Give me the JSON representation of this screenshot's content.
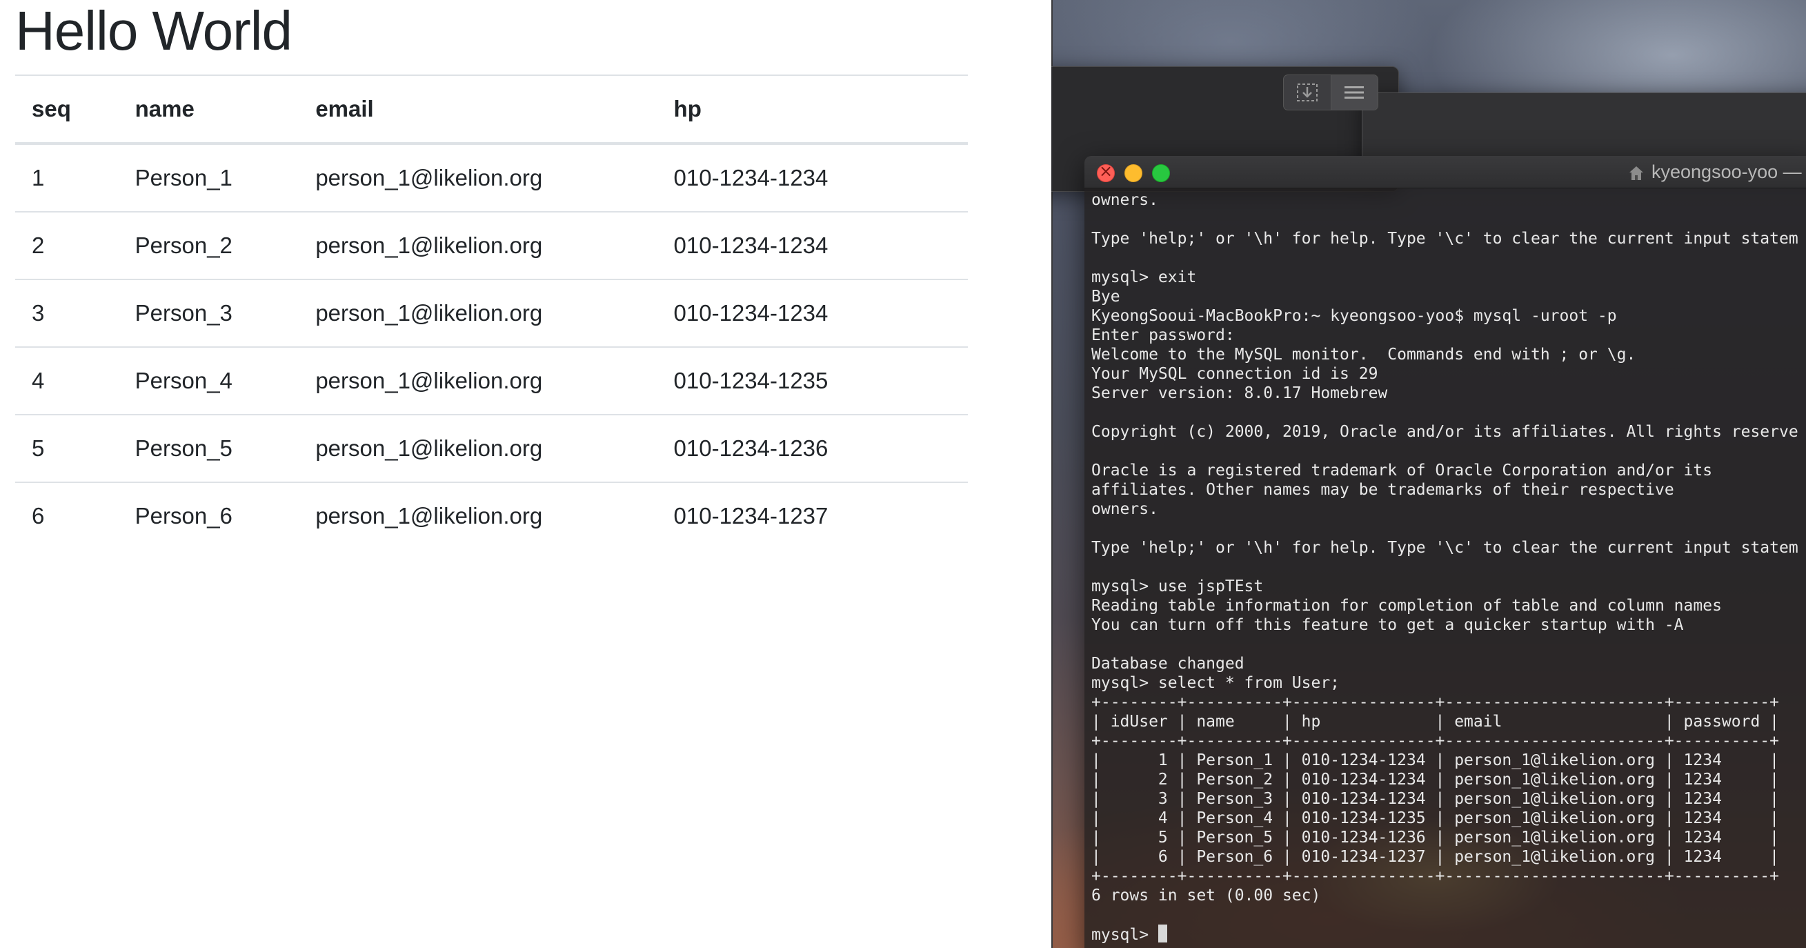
{
  "page": {
    "title": "Hello World",
    "columns": [
      "seq",
      "name",
      "email",
      "hp"
    ],
    "rows": [
      [
        "1",
        "Person_1",
        "person_1@likelion.org",
        "010-1234-1234"
      ],
      [
        "2",
        "Person_2",
        "person_1@likelion.org",
        "010-1234-1234"
      ],
      [
        "3",
        "Person_3",
        "person_1@likelion.org",
        "010-1234-1234"
      ],
      [
        "4",
        "Person_4",
        "person_1@likelion.org",
        "010-1234-1235"
      ],
      [
        "5",
        "Person_5",
        "person_1@likelion.org",
        "010-1234-1236"
      ],
      [
        "6",
        "Person_6",
        "person_1@likelion.org",
        "010-1234-1237"
      ]
    ]
  },
  "terminal": {
    "title": "kyeongsoo-yoo — m",
    "title_icon": "home-icon",
    "lines": [
      "owners.",
      "",
      "Type 'help;' or '\\h' for help. Type '\\c' to clear the current input statem",
      "",
      "mysql> exit",
      "Bye",
      "KyeongSooui-MacBookPro:~ kyeongsoo-yoo$ mysql -uroot -p",
      "Enter password:",
      "Welcome to the MySQL monitor.  Commands end with ; or \\g.",
      "Your MySQL connection id is 29",
      "Server version: 8.0.17 Homebrew",
      "",
      "Copyright (c) 2000, 2019, Oracle and/or its affiliates. All rights reserve",
      "",
      "Oracle is a registered trademark of Oracle Corporation and/or its",
      "affiliates. Other names may be trademarks of their respective",
      "owners.",
      "",
      "Type 'help;' or '\\h' for help. Type '\\c' to clear the current input statem",
      "",
      "mysql> use jspTEst",
      "Reading table information for completion of table and column names",
      "You can turn off this feature to get a quicker startup with -A",
      "",
      "Database changed",
      "mysql> select * from User;",
      "+--------+----------+---------------+-----------------------+----------+",
      "| idUser | name     | hp            | email                 | password |",
      "+--------+----------+---------------+-----------------------+----------+",
      "|      1 | Person_1 | 010-1234-1234 | person_1@likelion.org | 1234     |",
      "|      2 | Person_2 | 010-1234-1234 | person_1@likelion.org | 1234     |",
      "|      3 | Person_3 | 010-1234-1234 | person_1@likelion.org | 1234     |",
      "|      4 | Person_4 | 010-1234-1235 | person_1@likelion.org | 1234     |",
      "|      5 | Person_5 | 010-1234-1236 | person_1@likelion.org | 1234     |",
      "|      6 | Person_6 | 010-1234-1237 | person_1@likelion.org | 1234     |",
      "+--------+----------+---------------+-----------------------+----------+",
      "6 rows in set (0.00 sec)",
      ""
    ],
    "prompt": "mysql> "
  },
  "background_toolbar": {
    "icons": [
      "download-icon",
      "list-icon"
    ]
  },
  "colors": {
    "close": "#fe5f57",
    "minimize": "#febc2e",
    "zoom": "#28c840",
    "table_border": "#dee2e6"
  }
}
